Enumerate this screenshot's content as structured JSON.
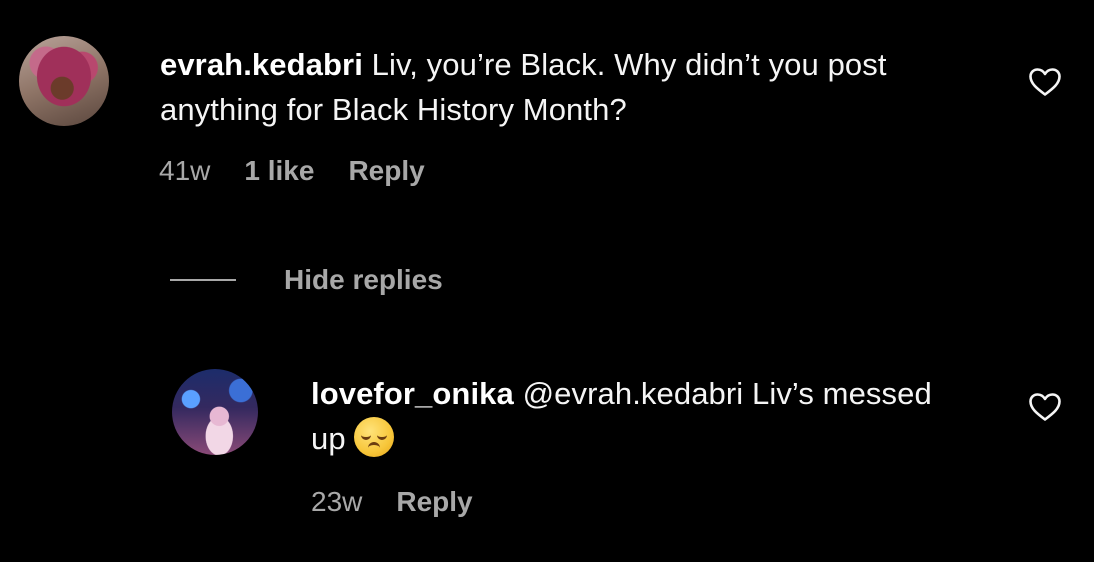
{
  "comments": [
    {
      "username": "evrah.kedabri",
      "text": " Liv, you’re Black. Why didn’t you post anything for Black History Month?",
      "time": "41w",
      "likes": "1 like",
      "reply_label": "Reply",
      "avatar_icon": "profile-photo-avatar",
      "like_icon": "heart-outline-icon"
    }
  ],
  "hide_replies_label": "Hide replies",
  "replies": [
    {
      "username": "lovefor_onika",
      "text": " @evrah.kedabri Liv’s messed up",
      "emoji": "pensive-face-emoji",
      "time": "23w",
      "reply_label": "Reply",
      "avatar_icon": "profile-photo-avatar",
      "like_icon": "heart-outline-icon"
    }
  ],
  "colors": {
    "background": "#000000",
    "primary_text": "#f5f5f5",
    "secondary_text": "#a8a8a8"
  }
}
